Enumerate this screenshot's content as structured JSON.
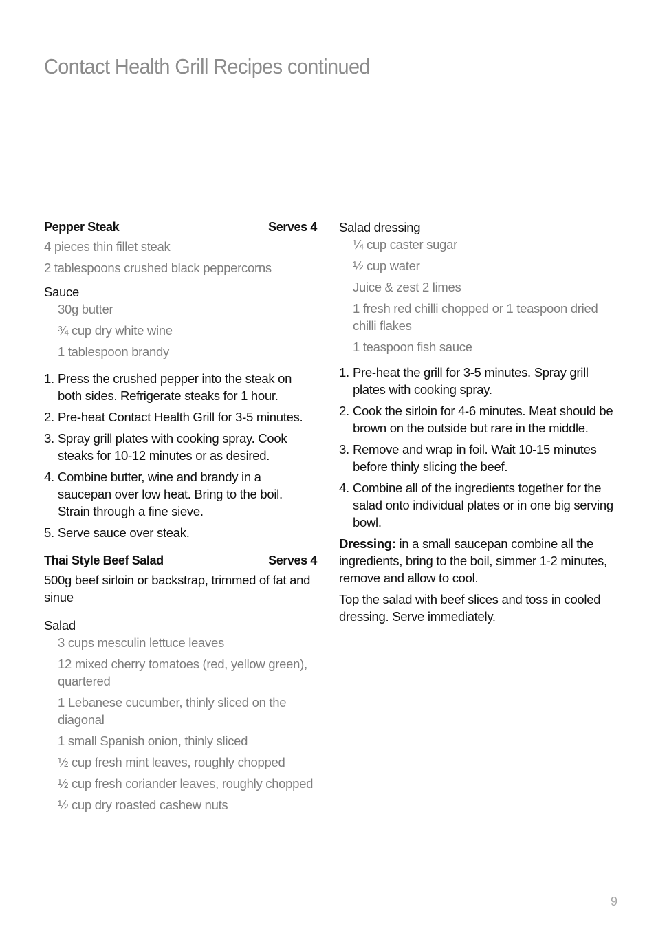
{
  "page": {
    "title": "Contact Health Grill Recipes continued",
    "page_number": "9"
  },
  "pepper_steak": {
    "title": "Pepper Steak",
    "serves": "Serves 4",
    "ingredients": [
      "4 pieces thin fillet steak",
      "2 tablespoons crushed black peppercorns"
    ],
    "sauce_heading": "Sauce",
    "sauce_ingredients": [
      "30g butter",
      "¾ cup dry white wine",
      "1 tablespoon brandy"
    ],
    "steps": [
      {
        "num": "1.",
        "text": "Press the crushed pepper into the steak on both sides. Refrigerate steaks for 1 hour."
      },
      {
        "num": "2.",
        "text": "Pre-heat Contact Health Grill for 3-5 minutes."
      },
      {
        "num": "3.",
        "text": "Spray grill plates with cooking spray. Cook steaks for 10-12 minutes or as desired."
      },
      {
        "num": "4.",
        "text": "Combine butter, wine and brandy in a saucepan over low heat. Bring to the boil. Strain through a fine sieve."
      },
      {
        "num": "5.",
        "text": "Serve sauce over steak."
      }
    ]
  },
  "thai_salad": {
    "title": "Thai Style Beef Salad",
    "serves": "Serves 4",
    "main_ingredient": "500g beef sirloin or backstrap, trimmed of fat and sinue",
    "salad_heading": "Salad",
    "salad_ingredients": [
      "3 cups mesculin lettuce leaves",
      "12 mixed cherry tomatoes (red, yellow green), quartered",
      "1 Lebanese cucumber, thinly sliced on the diagonal",
      "1 small Spanish onion, thinly sliced",
      "½ cup fresh mint leaves, roughly chopped",
      "½ cup fresh coriander leaves, roughly chopped",
      "½ cup dry roasted cashew nuts"
    ],
    "dressing_heading": "Salad dressing",
    "dressing_ingredients": [
      "¼ cup caster sugar",
      "½ cup water",
      "Juice & zest 2 limes",
      "1 fresh red chilli chopped or 1 teaspoon dried chilli flakes",
      "1 teaspoon fish sauce"
    ],
    "steps": [
      {
        "num": "1.",
        "text": "Pre-heat the grill for 3-5 minutes. Spray grill plates with cooking spray."
      },
      {
        "num": "2.",
        "text": "Cook the sirloin for 4-6 minutes. Meat should be brown on the outside but rare in the middle."
      },
      {
        "num": "3.",
        "text": "Remove and wrap in foil. Wait 10-15 minutes before thinly slicing the beef."
      },
      {
        "num": "4.",
        "text": "Combine all of the ingredients together for the salad onto individual plates or in one big serving bowl."
      }
    ],
    "dressing_note_label": "Dressing:",
    "dressing_note_text": " in a small saucepan combine all the ingredients, bring to the boil, simmer 1-2 minutes, remove and allow to cool.",
    "final_note": "Top the salad with beef slices and toss in cooled dressing. Serve immediately."
  }
}
